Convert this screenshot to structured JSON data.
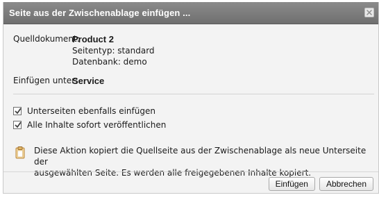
{
  "dialog": {
    "title": "Seite aus der Zwischenablage einfügen ...",
    "close_icon": "close-icon"
  },
  "details": {
    "source_label": "Quelldokument:",
    "source_name": "Product 2",
    "page_type": "Seitentyp: standard",
    "database": "Datenbank: demo",
    "insert_label": "Einfügen unter:",
    "insert_target": "Service"
  },
  "options": [
    {
      "label": "Unterseiten ebenfalls einfügen",
      "checked": true
    },
    {
      "label": "Alle Inhalte sofort veröffentlichen",
      "checked": true
    }
  ],
  "info": {
    "icon": "clipboard-icon",
    "text_line1": "Diese Aktion kopiert die Quellseite aus der Zwischenablage als neue Unterseite der",
    "text_line2": "ausgewählten Seite. Es werden alle freigegebenen Inhalte kopiert."
  },
  "buttons": {
    "insert_label": "Einfügen",
    "cancel_label": "Abbrechen"
  },
  "colors": {
    "titlebar": "#7f7f7f",
    "dialog_background": "#f3f3f3",
    "checkbox_check": "#3f3f3f",
    "clipboard_icon": "#d99b4a"
  }
}
